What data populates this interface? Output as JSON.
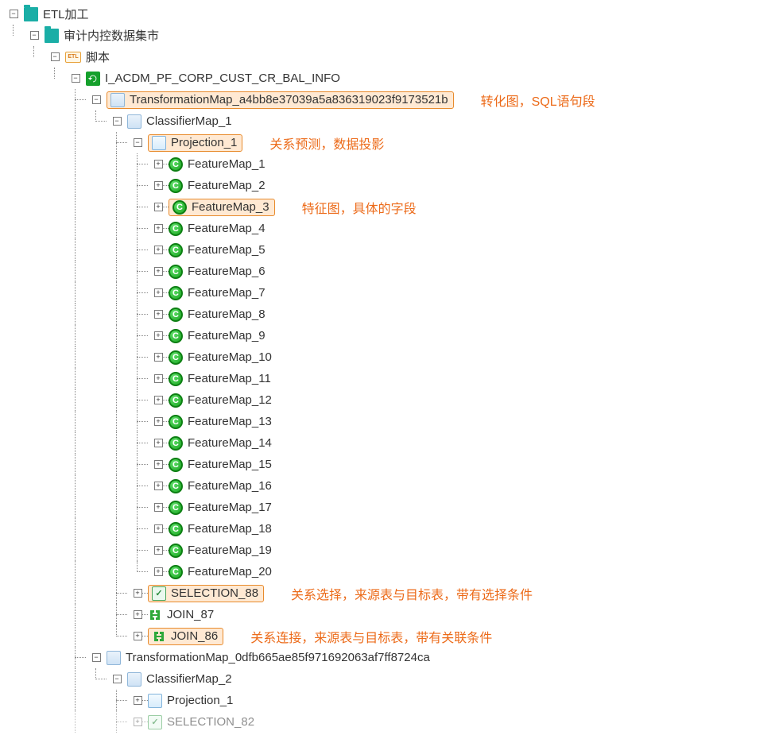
{
  "root": {
    "label": "ETL加工"
  },
  "sub1": {
    "label": "审计内控数据集市"
  },
  "script": {
    "label": "脚本",
    "etl_text": "ETL"
  },
  "job": {
    "label": "I_ACDM_PF_CORP_CUST_CR_BAL_INFO"
  },
  "tmap1": {
    "label": "TransformationMap_a4bb8e37039a5a836319023f9173521b"
  },
  "tmap1_anno": "转化图，SQL语句段",
  "cmap1": {
    "label": "ClassifierMap_1"
  },
  "proj1": {
    "label": "Projection_1"
  },
  "proj1_anno": "关系预测，数据投影",
  "features": [
    "FeatureMap_1",
    "FeatureMap_2",
    "FeatureMap_3",
    "FeatureMap_4",
    "FeatureMap_5",
    "FeatureMap_6",
    "FeatureMap_7",
    "FeatureMap_8",
    "FeatureMap_9",
    "FeatureMap_10",
    "FeatureMap_11",
    "FeatureMap_12",
    "FeatureMap_13",
    "FeatureMap_14",
    "FeatureMap_15",
    "FeatureMap_16",
    "FeatureMap_17",
    "FeatureMap_18",
    "FeatureMap_19",
    "FeatureMap_20"
  ],
  "feat3_anno": "特征图，具体的字段",
  "sel88": {
    "label": "SELECTION_88"
  },
  "sel88_anno": "关系选择，来源表与目标表，带有选择条件",
  "join87": {
    "label": "JOIN_87"
  },
  "join86": {
    "label": "JOIN_86"
  },
  "join86_anno": "关系连接，来源表与目标表，带有关联条件",
  "tmap2": {
    "label": "TransformationMap_0dfb665ae85f971692063af7ff8724ca"
  },
  "cmap2": {
    "label": "ClassifierMap_2"
  },
  "proj2": {
    "label": "Projection_1"
  },
  "sel82": {
    "label": "SELECTION_82"
  },
  "feat_letter": "C"
}
